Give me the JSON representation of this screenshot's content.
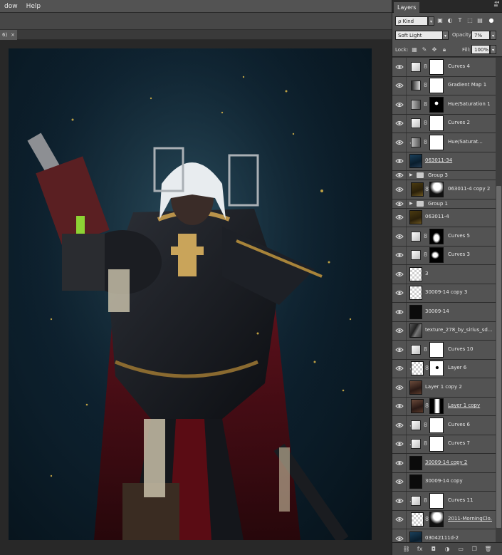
{
  "menubar": {
    "items": [
      "dow",
      "Help"
    ]
  },
  "doc_tab": {
    "label": "6)",
    "close": "×"
  },
  "panel": {
    "tab": "Layers",
    "close": "◂◂",
    "menu": "≡",
    "kind": "ρ Kind",
    "blend_mode": "Soft Light",
    "opacity_label": "Opacity:",
    "opacity_value": "7%",
    "lock_label": "Lock:",
    "fill_label": "Fill:",
    "fill_value": "100%"
  },
  "layers": [
    {
      "name": "Curves 4",
      "type": "adj",
      "icon": "curves",
      "mask": "white"
    },
    {
      "name": "Gradient Map 1",
      "type": "adj",
      "icon": "grad",
      "mask": "white"
    },
    {
      "name": "Hue/Saturation 1",
      "type": "adj",
      "icon": "hue",
      "mask": "hue-dot"
    },
    {
      "name": "Curves 2",
      "type": "adj",
      "icon": "curves",
      "mask": "white"
    },
    {
      "name": "Hue/Saturat...",
      "type": "adj",
      "icon": "hue",
      "mask": "white",
      "clip": true
    },
    {
      "name": "063011-34",
      "type": "pixel",
      "thumb": "photo-t",
      "underline": true
    },
    {
      "name": "Group 3",
      "type": "group"
    },
    {
      "name": "063011-4 copy 2",
      "type": "pixelmask",
      "thumb": "gold-t",
      "mask": "white-blob"
    },
    {
      "name": "Group 1",
      "type": "group"
    },
    {
      "name": "063011-4",
      "type": "pixel",
      "thumb": "gold-t"
    },
    {
      "name": "Curves 5",
      "type": "adj",
      "icon": "curves",
      "mask": "shape"
    },
    {
      "name": "Curves 3",
      "type": "adj",
      "icon": "curves",
      "mask": "shape2"
    },
    {
      "name": "3",
      "type": "pixel",
      "thumb": "checker"
    },
    {
      "name": "30009-14 copy 3",
      "type": "pixel",
      "thumb": "checker"
    },
    {
      "name": "30009-14",
      "type": "pixel",
      "thumb": "dark-t"
    },
    {
      "name": "texture_278_by_sirius_sd...",
      "type": "pixel",
      "thumb": "texture-t"
    },
    {
      "name": "Curves 10",
      "type": "adj",
      "icon": "curves",
      "mask": "white"
    },
    {
      "name": "Layer 6",
      "type": "pixelmask",
      "thumb": "checker",
      "mask": "dot",
      "clip": true
    },
    {
      "name": "Layer 1 copy 2",
      "type": "pixel",
      "thumb": "person-t",
      "clip": true
    },
    {
      "name": "Layer 1 copy",
      "type": "pixelmask",
      "thumb": "person-t",
      "mask": "person-m",
      "underline": true
    },
    {
      "name": "Curves 6",
      "type": "adj",
      "icon": "curves",
      "mask": "white",
      "clip": true
    },
    {
      "name": "Curves 7",
      "type": "adj",
      "icon": "curves",
      "mask": "white",
      "clip": true
    },
    {
      "name": "30009-14 copy 2",
      "type": "pixel",
      "thumb": "dark-t",
      "underline": true
    },
    {
      "name": "30009-14 copy",
      "type": "pixel",
      "thumb": "dark-t"
    },
    {
      "name": "Curves 11",
      "type": "adj",
      "icon": "curves",
      "mask": "white",
      "clip": true
    },
    {
      "name": "2011-MorningClo...",
      "type": "pixelmask",
      "thumb": "checker",
      "mask": "white-blob",
      "underline": true
    },
    {
      "name": "03042111d-2",
      "type": "pixel",
      "thumb": "photo-t"
    }
  ],
  "footer_icons": [
    "link-icon",
    "fx-icon",
    "mask-icon",
    "adjustment-icon",
    "folder-icon",
    "new-layer-icon",
    "trash-icon"
  ]
}
